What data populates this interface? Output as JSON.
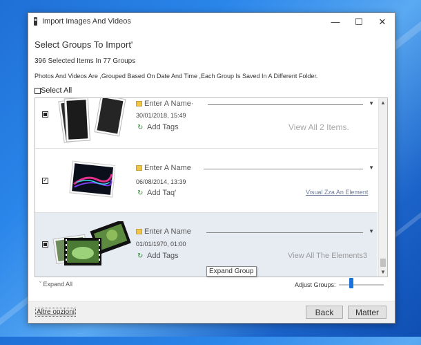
{
  "window": {
    "title": "Import Images And Videos",
    "controls": {
      "minimize": "—",
      "maximize": "☐",
      "close": "✕"
    }
  },
  "header": {
    "heading": "Select Groups To Import'",
    "selected_count": "396 Selected Items In 77 Groups",
    "grouping_info": "Photos And Videos Are ,Grouped Based On Date And Time ,Each Group Is Saved In A Different Folder."
  },
  "select_all": {
    "label": "Select All",
    "checked": false
  },
  "groups": [
    {
      "name_placeholder": "Enter A Name·",
      "date": "30/01/2018, 15:49",
      "add_tags": "Add Tags",
      "view_link": "View All 2 Items.",
      "checkbox_state": "indeterminate",
      "thumbnail": "portrait-stack-icon"
    },
    {
      "name_placeholder": "Enter A Name",
      "date": "06/08/2014, 13:39",
      "add_tags": "Add Taq'",
      "view_link": "Visual Zza An Element",
      "checkbox_state": "checked",
      "thumbnail": "abstract-image-icon"
    },
    {
      "name_placeholder": "Enter A Name",
      "date": "01/01/1970, 01:00",
      "add_tags": "Add Tags",
      "view_link": "View All The Elements3",
      "checkbox_state": "indeterminate",
      "thumbnail": "film-stack-icon"
    }
  ],
  "tooltip": "Expand Group",
  "footer": {
    "expand_all": "Expand All",
    "adjust_groups_label": "Adjust Groups:",
    "adjust_groups_level": 0.25,
    "more_options": "Altre opzioni",
    "back_button": "Back",
    "matter_button": "Matter"
  },
  "colors": {
    "accent": "#1a73d9",
    "desktop": "#2a86ea",
    "selected_row": "#e7ebf2",
    "folder": "#f0c64a"
  }
}
